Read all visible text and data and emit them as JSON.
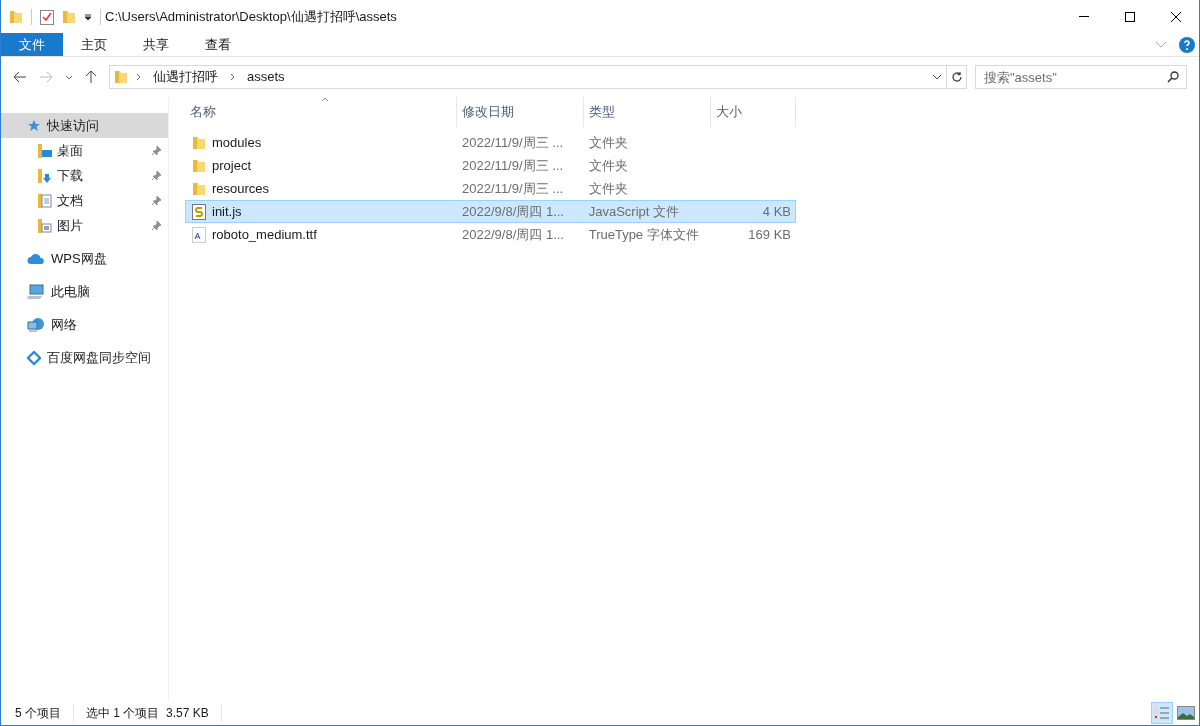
{
  "title_bar": {
    "path": "C:\\Users\\Administrator\\Desktop\\仙遇打招呼\\assets"
  },
  "ribbon_tabs": [
    {
      "label": "文件",
      "selected": true
    },
    {
      "label": "主页",
      "selected": false
    },
    {
      "label": "共享",
      "selected": false
    },
    {
      "label": "查看",
      "selected": false
    }
  ],
  "address_bar": {
    "crumbs": [
      "仙遇打招呼",
      "assets"
    ]
  },
  "search": {
    "placeholder": "搜索\"assets\""
  },
  "sidebar": {
    "items": [
      {
        "label": "快速访问",
        "kind": "star",
        "selected": true,
        "children": [
          {
            "label": "桌面",
            "kind": "desktop",
            "pinned": true,
            "selected": false
          },
          {
            "label": "下载",
            "kind": "download",
            "pinned": true,
            "selected": false
          },
          {
            "label": "文档",
            "kind": "document",
            "pinned": true,
            "selected": false
          },
          {
            "label": "图片",
            "kind": "picture",
            "pinned": true,
            "selected": false
          }
        ]
      },
      {
        "label": "WPS网盘",
        "kind": "cloud",
        "selected": false
      },
      {
        "label": "此电脑",
        "kind": "computer",
        "selected": false
      },
      {
        "label": "网络",
        "kind": "network",
        "selected": false
      },
      {
        "label": "百度网盘同步空间",
        "kind": "sync",
        "selected": false
      }
    ]
  },
  "table": {
    "columns": [
      {
        "label": "名称",
        "sorted": true
      },
      {
        "label": "修改日期",
        "sorted": false
      },
      {
        "label": "类型",
        "sorted": false
      },
      {
        "label": "大小",
        "sorted": false
      }
    ],
    "rows": [
      {
        "kind": "folder",
        "name": "modules",
        "modified": "2022/11/9/周三 ...",
        "type": "文件夹",
        "selected": false
      },
      {
        "kind": "folder",
        "name": "project",
        "modified": "2022/11/9/周三 ...",
        "type": "文件夹",
        "selected": false
      },
      {
        "kind": "folder",
        "name": "resources",
        "modified": "2022/11/9/周三 ...",
        "type": "文件夹",
        "selected": false
      },
      {
        "kind": "script",
        "name": "init.js",
        "modified": "2022/9/8/周四 1...",
        "type": "JavaScript 文件",
        "size": "4 KB",
        "selected": true
      },
      {
        "kind": "font",
        "name": "roboto_medium.ttf",
        "modified": "2022/9/8/周四 1...",
        "type": "TrueType 字体文件",
        "size": "169 KB",
        "selected": false
      }
    ]
  },
  "status_bar": {
    "count": "5 个项目",
    "selection": "选中 1 个项目  3.57 KB"
  },
  "view_buttons": [
    {
      "kind": "details",
      "selected": true
    },
    {
      "kind": "thumbnails",
      "selected": false
    }
  ]
}
